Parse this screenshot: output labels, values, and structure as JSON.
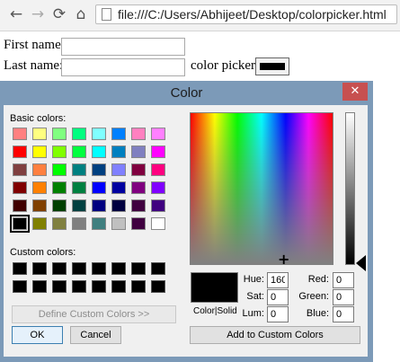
{
  "browser": {
    "url": "file:///C:/Users/Abhijeet/Desktop/colorpicker.html",
    "icons": {
      "back": "back-arrow-icon",
      "forward": "forward-arrow-icon",
      "reload": "reload-icon",
      "home": "home-icon",
      "page": "page-icon"
    }
  },
  "form": {
    "first_name_label": "First name:",
    "first_name_value": "",
    "last_name_label": "Last name:",
    "last_name_value": "",
    "color_picker_label": "color picker :",
    "color_value": "#000000"
  },
  "dialog": {
    "title": "Color",
    "close_symbol": "✕",
    "basic_colors_label": "Basic colors:",
    "custom_colors_label": "Custom colors:",
    "define_custom_label": "Define Custom Colors >>",
    "ok_label": "OK",
    "cancel_label": "Cancel",
    "add_custom_label": "Add to Custom Colors",
    "color_solid_label": "Color|Solid",
    "fields": {
      "hue_label": "Hue:",
      "hue": "160",
      "sat_label": "Sat:",
      "sat": "0",
      "lum_label": "Lum:",
      "lum": "0",
      "red_label": "Red:",
      "red": "0",
      "green_label": "Green:",
      "green": "0",
      "blue_label": "Blue:",
      "blue": "0"
    },
    "basic_colors": [
      [
        "#ff8080",
        "#ffff80",
        "#80ff80",
        "#00ff80",
        "#80ffff",
        "#0080ff",
        "#ff80c0",
        "#ff80ff"
      ],
      [
        "#ff0000",
        "#ffff00",
        "#80ff00",
        "#00ff40",
        "#00ffff",
        "#0080c0",
        "#8080c0",
        "#ff00ff"
      ],
      [
        "#804040",
        "#ff8040",
        "#00ff00",
        "#008080",
        "#004080",
        "#8080ff",
        "#800040",
        "#ff0080"
      ],
      [
        "#800000",
        "#ff8000",
        "#008000",
        "#008040",
        "#0000ff",
        "#0000a0",
        "#800080",
        "#8000ff"
      ],
      [
        "#400000",
        "#804000",
        "#004000",
        "#004040",
        "#000080",
        "#000040",
        "#400040",
        "#400080"
      ],
      [
        "#000000",
        "#808000",
        "#808040",
        "#808080",
        "#408080",
        "#c0c0c0",
        "#400040",
        "#ffffff"
      ]
    ],
    "selected_basic": [
      5,
      0
    ],
    "custom_colors": [
      [
        "#000000",
        "#000000",
        "#000000",
        "#000000",
        "#000000",
        "#000000",
        "#000000",
        "#000000"
      ],
      [
        "#000000",
        "#000000",
        "#000000",
        "#000000",
        "#000000",
        "#000000",
        "#000000",
        "#000000"
      ]
    ],
    "current_color": "#000000"
  }
}
